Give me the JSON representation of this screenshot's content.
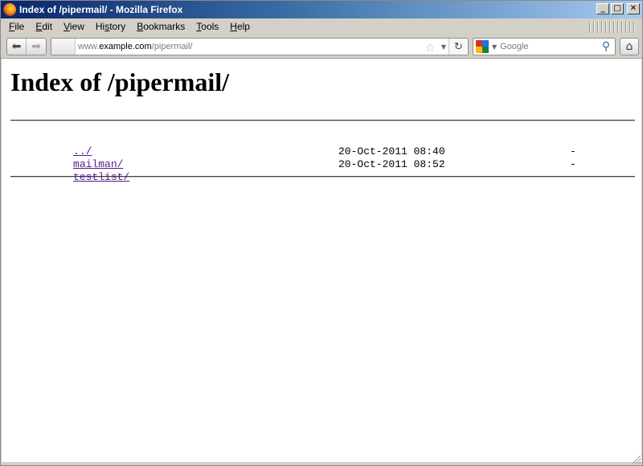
{
  "window": {
    "title": "Index of /pipermail/ - Mozilla Firefox",
    "controls": {
      "minimize": "_",
      "maximize": "□",
      "close": "✕"
    }
  },
  "menu": {
    "items": [
      {
        "accel": "F",
        "rest": "ile"
      },
      {
        "accel": "E",
        "rest": "dit"
      },
      {
        "accel": "V",
        "rest": "iew"
      },
      {
        "accel": "",
        "pre": "Hi",
        "accel2": "s",
        "rest": "tory"
      },
      {
        "accel": "B",
        "rest": "ookmarks"
      },
      {
        "accel": "T",
        "rest": "ools"
      },
      {
        "accel": "H",
        "rest": "elp"
      }
    ]
  },
  "navbar": {
    "back_glyph": "⬅",
    "forward_glyph": "➡",
    "url": {
      "prefix": "www.",
      "host": "example.com",
      "path": "/pipermail/"
    },
    "star_glyph": "☆",
    "reload_glyph": "↻",
    "search_placeholder": "Google",
    "search_glyph": "⚲",
    "home_glyph": "⌂"
  },
  "page": {
    "heading": "Index of /pipermail/",
    "entries": [
      {
        "name": "../",
        "date": "",
        "size": ""
      },
      {
        "name": "mailman/",
        "date": "20-Oct-2011 08:40",
        "size": "-"
      },
      {
        "name": "testlist/",
        "date": "20-Oct-2011 08:52",
        "size": "-"
      }
    ]
  },
  "colors": {
    "link_visited": "#551a8b",
    "titlebar_start": "#0a246a",
    "titlebar_end": "#a6caf0"
  }
}
